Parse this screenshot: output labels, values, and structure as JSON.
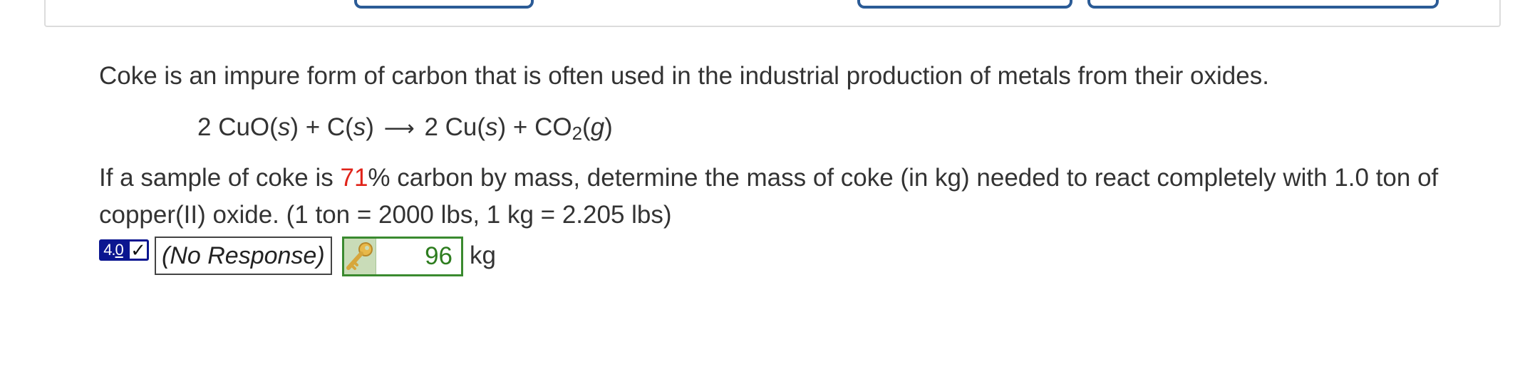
{
  "intro_text": "Coke is an impure form of carbon that is often used in the industrial production of metals from their oxides.",
  "equation": {
    "lhs": "2 CuO(",
    "lhs_state1": "s",
    "lhs_mid": ") + C(",
    "lhs_state2": "s",
    "lhs_end": ")",
    "arrow": "⟶",
    "rhs": "2 Cu(",
    "rhs_state1": "s",
    "rhs_mid": ") + CO",
    "rhs_sub": "2",
    "rhs_paren": "(",
    "rhs_state2": "g",
    "rhs_end": ")"
  },
  "question": {
    "part1": "If a sample of coke is ",
    "highlight": "71",
    "part2": "% carbon by mass, determine the mass of coke (in kg) needed to react completely with 1.0 ton of copper(II) oxide. (1 ton = 2000 lbs, 1 kg = 2.205 lbs)"
  },
  "answer": {
    "score_whole": "4.",
    "score_frac": "0",
    "check_mark": "✓",
    "student_response": "(No Response)",
    "key_value": "96",
    "unit": "kg",
    "key_icon": "key-icon"
  },
  "colors": {
    "highlight": "#e0241a",
    "badge": "#0b1690",
    "correct_green": "#2e7d1f",
    "button_border": "#2b5b96"
  }
}
